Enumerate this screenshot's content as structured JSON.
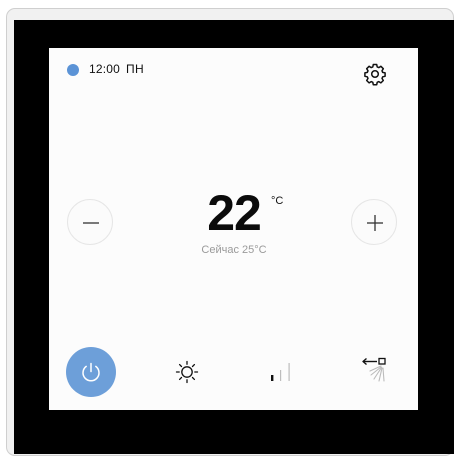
{
  "status": {
    "time": "12:00",
    "day": "ПН",
    "indicator_color": "#5b93d6"
  },
  "settings": {
    "icon": "gear-icon"
  },
  "temperature": {
    "setpoint": "22",
    "unit": "°C",
    "current_label": "Сейчас 25°C"
  },
  "controls": {
    "decrease_icon": "minus-icon",
    "increase_icon": "plus-icon"
  },
  "bottom_bar": {
    "power": {
      "icon": "power-icon",
      "color": "#6d9fd9",
      "state": "on"
    },
    "mode": {
      "icon": "sun-icon"
    },
    "fan_speed": {
      "icon": "fan-speed-bars-icon",
      "level": 1,
      "levels": 3
    },
    "swing": {
      "icon": "swing-icon"
    }
  }
}
